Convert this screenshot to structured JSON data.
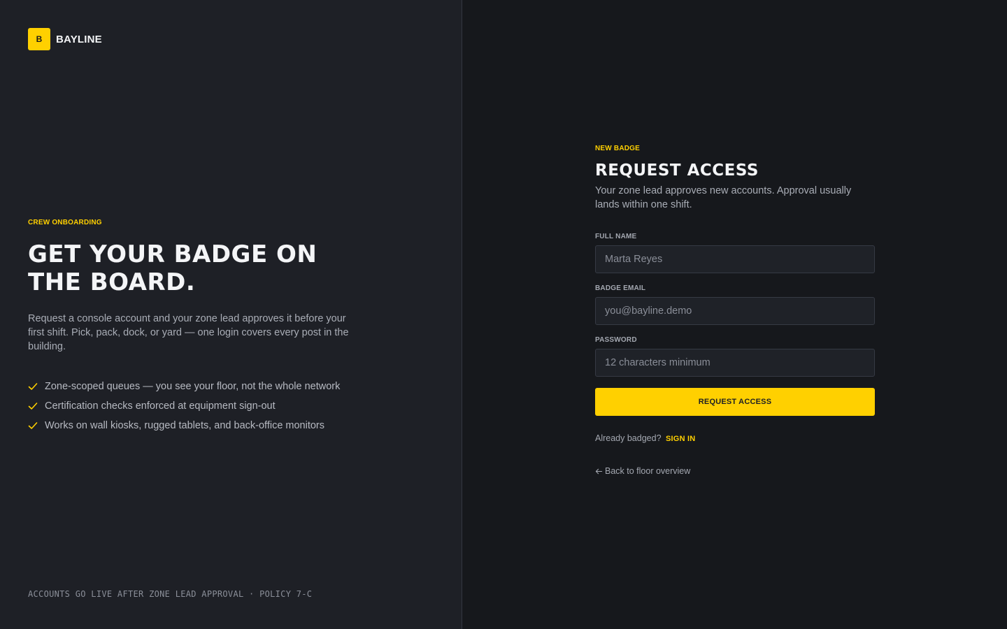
{
  "brand": {
    "mark": "B",
    "name": "BAYLINE"
  },
  "hero": {
    "eyebrow": "CREW ONBOARDING",
    "title": "GET YOUR BADGE ON THE BOARD.",
    "description": "Request a console account and your zone lead approves it before your first shift. Pick, pack, dock, or yard — one login covers every post in the building.",
    "features": [
      "Zone-scoped queues — you see your floor, not the whole network",
      "Certification checks enforced at equipment sign-out",
      "Works on wall kiosks, rugged tablets, and back-office monitors"
    ],
    "feature_icon": "check-icon"
  },
  "footer": {
    "policy": "ACCOUNTS GO LIVE AFTER ZONE LEAD APPROVAL · POLICY 7-C"
  },
  "form": {
    "eyebrow": "NEW BADGE",
    "title": "REQUEST ACCESS",
    "description": "Your zone lead approves new accounts. Approval usually lands within one shift.",
    "fields": {
      "full_name": {
        "label": "FULL NAME",
        "value": "",
        "placeholder": "Marta Reyes"
      },
      "email": {
        "label": "BADGE EMAIL",
        "value": "",
        "placeholder": "you@bayline.demo"
      },
      "password": {
        "label": "PASSWORD",
        "value": "",
        "placeholder": "12 characters minimum"
      }
    },
    "submit_label": "REQUEST ACCESS",
    "signin_prompt": "Already badged?",
    "signin_link": "SIGN IN",
    "back_link": "Back to floor overview"
  },
  "colors": {
    "accent": "#ffd000",
    "left_panel_bg": "#1e2026",
    "right_panel_bg": "#16181c",
    "input_bg": "#1f2228",
    "input_border": "#363a44"
  }
}
